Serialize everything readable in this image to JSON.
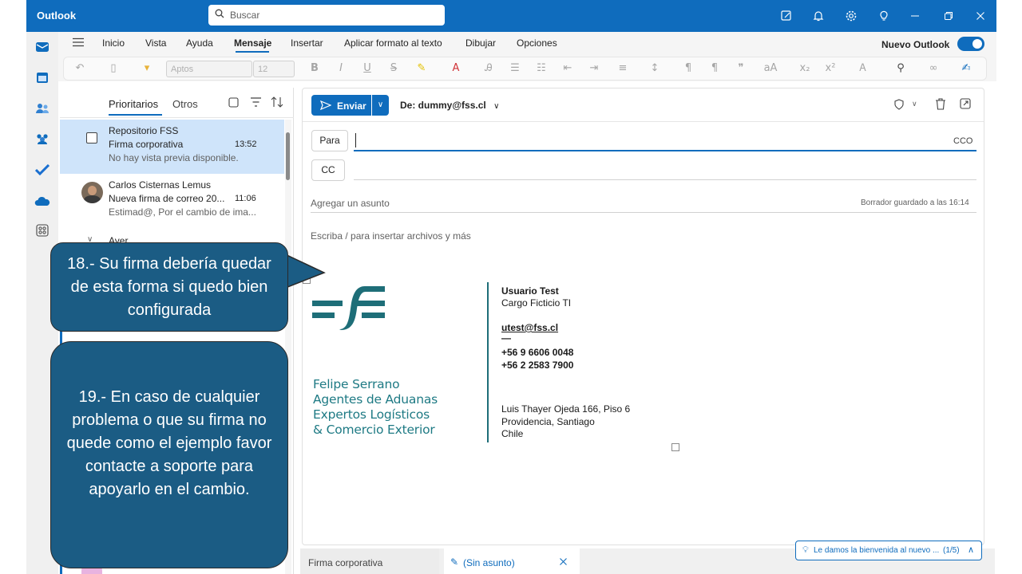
{
  "titlebar": {
    "app_name": "Outlook",
    "search_placeholder": "Buscar"
  },
  "ribbon": {
    "tabs": [
      "Inicio",
      "Vista",
      "Ayuda",
      "Mensaje",
      "Insertar",
      "Aplicar formato al texto",
      "Dibujar",
      "Opciones"
    ],
    "active_tab": "Mensaje",
    "new_outlook_label": "Nuevo Outlook",
    "font_name": "Aptos",
    "font_size": "12"
  },
  "list": {
    "tab_focused": "Prioritarios",
    "tab_other": "Otros",
    "mails": [
      {
        "sender": "Repositorio FSS",
        "subject": "Firma corporativa",
        "time": "13:52",
        "preview": "No hay vista previa disponible."
      },
      {
        "sender": "Carlos Cisternas Lemus",
        "subject": "Nueva firma de correo 20...",
        "time": "11:06",
        "preview": "Estimad@, Por el cambio de ima..."
      }
    ],
    "group_header": "Ayer"
  },
  "compose": {
    "send_label": "Enviar",
    "from_label": "De: dummy@fss.cl",
    "to_label": "Para",
    "cc_label": "CC",
    "bcc_label": "CCO",
    "subject_placeholder": "Agregar un asunto",
    "draft_saved": "Borrador guardado a las 16:14",
    "body_placeholder": "Escriba / para insertar archivos y más"
  },
  "signature": {
    "name": "Usuario Test",
    "role": "Cargo Ficticio TI",
    "email": "utest@fss.cl",
    "dash": "—",
    "phone1": "+56 9 6606 0048",
    "phone2": "+56 2 2583 7900",
    "address1": "Luis Thayer Ojeda 166, Piso 6",
    "address2": "Providencia, Santiago",
    "address3": "Chile",
    "company_line1": "Felipe Serrano",
    "company_line2": "Agentes de Aduanas",
    "company_line3": "Expertos Logísticos",
    "company_line4": "& Comercio Exterior",
    "brand_color": "#1e7a84"
  },
  "callouts": {
    "step18": "18.- Su firma debería quedar de esta forma si quedo bien configurada",
    "step19": "19.- En caso de cualquier problema o que su firma no quede como el ejemplo favor contacte a soporte para apoyarlo en el cambio."
  },
  "bottom": {
    "tab1": "Firma corporativa",
    "tab2": "(Sin asunto)",
    "welcome": "Le damos la bienvenida al nuevo ...",
    "welcome_count": "(1/5)"
  },
  "colors": {
    "accent": "#0f6cbd",
    "callout": "#1b5c84"
  }
}
